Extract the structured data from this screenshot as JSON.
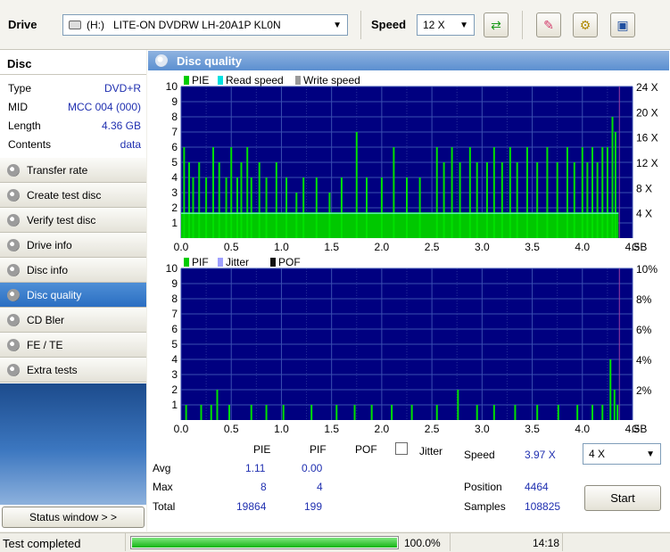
{
  "toolbar": {
    "drive_label": "Drive",
    "drive_value": "(H:)   LITE-ON DVDRW LH-20A1P KL0N",
    "speed_label": "Speed",
    "speed_value": "12 X",
    "icons": [
      "drive-icon",
      "refresh-icon",
      "erase-icon",
      "settings-icon",
      "save-icon"
    ]
  },
  "disc": {
    "header": "Disc",
    "rows": [
      {
        "key": "Type",
        "value": "DVD+R"
      },
      {
        "key": "MID",
        "value": "MCC 004 (000)"
      },
      {
        "key": "Length",
        "value": "4.36 GB"
      },
      {
        "key": "Contents",
        "value": "data"
      }
    ]
  },
  "menu": {
    "items": [
      {
        "label": "Transfer rate",
        "active": false
      },
      {
        "label": "Create test disc",
        "active": false
      },
      {
        "label": "Verify test disc",
        "active": false
      },
      {
        "label": "Drive info",
        "active": false
      },
      {
        "label": "Disc info",
        "active": false
      },
      {
        "label": "Disc quality",
        "active": true
      },
      {
        "label": "CD Bler",
        "active": false
      },
      {
        "label": "FE / TE",
        "active": false
      },
      {
        "label": "Extra tests",
        "active": false
      }
    ],
    "status_window": "Status window > >"
  },
  "panel": {
    "title": "Disc quality"
  },
  "chart_data": [
    {
      "type": "bar",
      "legend": [
        "PIE",
        "Read speed",
        "Write speed"
      ],
      "legend_colors": [
        "#00cc00",
        "#00e0e0",
        "#9a9a9a"
      ],
      "x_ticks": [
        "0.0",
        "0.5",
        "1.0",
        "1.5",
        "2.0",
        "2.5",
        "3.0",
        "3.5",
        "4.0",
        "4.5"
      ],
      "x_unit": "GB",
      "xlim": [
        0,
        4.5
      ],
      "y_left_ticks": [
        "1",
        "2",
        "3",
        "4",
        "5",
        "6",
        "7",
        "8",
        "9",
        "10"
      ],
      "ylim": [
        0,
        10
      ],
      "y_right_ticks": [
        "4 X",
        "8 X",
        "12 X",
        "16 X",
        "20 X",
        "24 X"
      ],
      "y_right_lim": [
        0,
        24
      ],
      "data_end": 4.36,
      "base_level": 1.7,
      "read_speed_level": 1.7,
      "pie_spikes": [
        {
          "x": 0.03,
          "y": 6
        },
        {
          "x": 0.08,
          "y": 5
        },
        {
          "x": 0.12,
          "y": 4
        },
        {
          "x": 0.18,
          "y": 5
        },
        {
          "x": 0.25,
          "y": 4
        },
        {
          "x": 0.32,
          "y": 6
        },
        {
          "x": 0.38,
          "y": 5
        },
        {
          "x": 0.45,
          "y": 4
        },
        {
          "x": 0.5,
          "y": 6
        },
        {
          "x": 0.56,
          "y": 4
        },
        {
          "x": 0.6,
          "y": 5
        },
        {
          "x": 0.66,
          "y": 6
        },
        {
          "x": 0.7,
          "y": 4
        },
        {
          "x": 0.78,
          "y": 5
        },
        {
          "x": 0.85,
          "y": 4
        },
        {
          "x": 0.95,
          "y": 5
        },
        {
          "x": 1.05,
          "y": 4
        },
        {
          "x": 1.15,
          "y": 3
        },
        {
          "x": 1.22,
          "y": 4
        },
        {
          "x": 1.35,
          "y": 4
        },
        {
          "x": 1.48,
          "y": 3
        },
        {
          "x": 1.6,
          "y": 4
        },
        {
          "x": 1.75,
          "y": 7
        },
        {
          "x": 1.85,
          "y": 4
        },
        {
          "x": 2.0,
          "y": 4
        },
        {
          "x": 2.12,
          "y": 6
        },
        {
          "x": 2.25,
          "y": 4
        },
        {
          "x": 2.38,
          "y": 4
        },
        {
          "x": 2.55,
          "y": 6
        },
        {
          "x": 2.62,
          "y": 5
        },
        {
          "x": 2.7,
          "y": 6
        },
        {
          "x": 2.78,
          "y": 5
        },
        {
          "x": 2.88,
          "y": 6
        },
        {
          "x": 2.95,
          "y": 5
        },
        {
          "x": 3.05,
          "y": 5
        },
        {
          "x": 3.12,
          "y": 6
        },
        {
          "x": 3.2,
          "y": 5
        },
        {
          "x": 3.28,
          "y": 6
        },
        {
          "x": 3.35,
          "y": 5
        },
        {
          "x": 3.45,
          "y": 6
        },
        {
          "x": 3.55,
          "y": 5
        },
        {
          "x": 3.65,
          "y": 6
        },
        {
          "x": 3.75,
          "y": 5
        },
        {
          "x": 3.85,
          "y": 6
        },
        {
          "x": 3.92,
          "y": 5
        },
        {
          "x": 4.0,
          "y": 6
        },
        {
          "x": 4.05,
          "y": 5
        },
        {
          "x": 4.1,
          "y": 6
        },
        {
          "x": 4.15,
          "y": 5
        },
        {
          "x": 4.2,
          "y": 6
        },
        {
          "x": 4.25,
          "y": 6
        },
        {
          "x": 4.3,
          "y": 8
        },
        {
          "x": 4.33,
          "y": 7
        }
      ]
    },
    {
      "type": "bar",
      "legend": [
        "PIF",
        "Jitter",
        "POF"
      ],
      "legend_colors": [
        "#00cc00",
        "#9fa0ff",
        "#111111"
      ],
      "x_ticks": [
        "0.0",
        "0.5",
        "1.0",
        "1.5",
        "2.0",
        "2.5",
        "3.0",
        "3.5",
        "4.0",
        "4.5"
      ],
      "x_unit": "GB",
      "xlim": [
        0,
        4.5
      ],
      "y_left_ticks": [
        "1",
        "2",
        "3",
        "4",
        "5",
        "6",
        "7",
        "8",
        "9",
        "10"
      ],
      "ylim": [
        0,
        10
      ],
      "y_right_ticks": [
        "2%",
        "4%",
        "6%",
        "8%",
        "10%"
      ],
      "y_right_lim": [
        0,
        10
      ],
      "data_end": 4.36,
      "pif_spikes": [
        {
          "x": 0.05,
          "y": 1
        },
        {
          "x": 0.2,
          "y": 1
        },
        {
          "x": 0.3,
          "y": 1
        },
        {
          "x": 0.36,
          "y": 2
        },
        {
          "x": 0.48,
          "y": 1
        },
        {
          "x": 0.7,
          "y": 1
        },
        {
          "x": 0.85,
          "y": 1
        },
        {
          "x": 1.02,
          "y": 1
        },
        {
          "x": 1.3,
          "y": 1
        },
        {
          "x": 1.55,
          "y": 1
        },
        {
          "x": 1.73,
          "y": 1
        },
        {
          "x": 1.9,
          "y": 1
        },
        {
          "x": 2.1,
          "y": 1
        },
        {
          "x": 2.3,
          "y": 1
        },
        {
          "x": 2.55,
          "y": 1
        },
        {
          "x": 2.76,
          "y": 2
        },
        {
          "x": 2.95,
          "y": 1
        },
        {
          "x": 3.12,
          "y": 1
        },
        {
          "x": 3.33,
          "y": 1
        },
        {
          "x": 3.55,
          "y": 1
        },
        {
          "x": 3.76,
          "y": 1
        },
        {
          "x": 3.95,
          "y": 1
        },
        {
          "x": 4.1,
          "y": 1
        },
        {
          "x": 4.2,
          "y": 1
        },
        {
          "x": 4.28,
          "y": 4
        },
        {
          "x": 4.32,
          "y": 2
        },
        {
          "x": 4.35,
          "y": 1
        }
      ]
    }
  ],
  "stats": {
    "headers": [
      "PIE",
      "PIF",
      "POF"
    ],
    "jitter_label": "Jitter",
    "rows": [
      {
        "label": "Avg",
        "pie": "1.11",
        "pif": "0.00"
      },
      {
        "label": "Max",
        "pie": "8",
        "pif": "4"
      },
      {
        "label": "Total",
        "pie": "19864",
        "pif": "199"
      }
    ],
    "speed_label": "Speed",
    "speed_value": "3.97 X",
    "speed_select": "4 X",
    "position_label": "Position",
    "position_value": "4464",
    "samples_label": "Samples",
    "samples_value": "108825",
    "start_label": "Start"
  },
  "statusbar": {
    "message": "Test completed",
    "progress_fraction": 1.0,
    "progress_text": "100.0%",
    "time": "14:18"
  }
}
